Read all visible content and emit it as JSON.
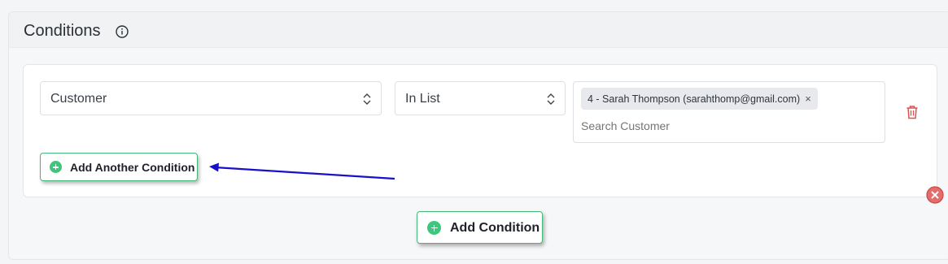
{
  "header": {
    "title": "Conditions",
    "info_icon": "info-icon"
  },
  "condition": {
    "field": "Customer",
    "operator": "In List",
    "selected_tags": [
      {
        "label": "4 - Sarah Thompson (sarahthomp@gmail.com)",
        "remove": "×"
      }
    ],
    "search_placeholder": "Search Customer",
    "delete_icon": "trash-icon"
  },
  "buttons": {
    "add_another_label": "Add Another Condition",
    "add_condition_label": "Add Condition",
    "remove_group_icon": "close-circle-icon"
  },
  "colors": {
    "accent_green": "#3ec67f",
    "button_border": "#45b879",
    "danger": "#d9534f",
    "annotation_arrow": "#1a10c8"
  }
}
